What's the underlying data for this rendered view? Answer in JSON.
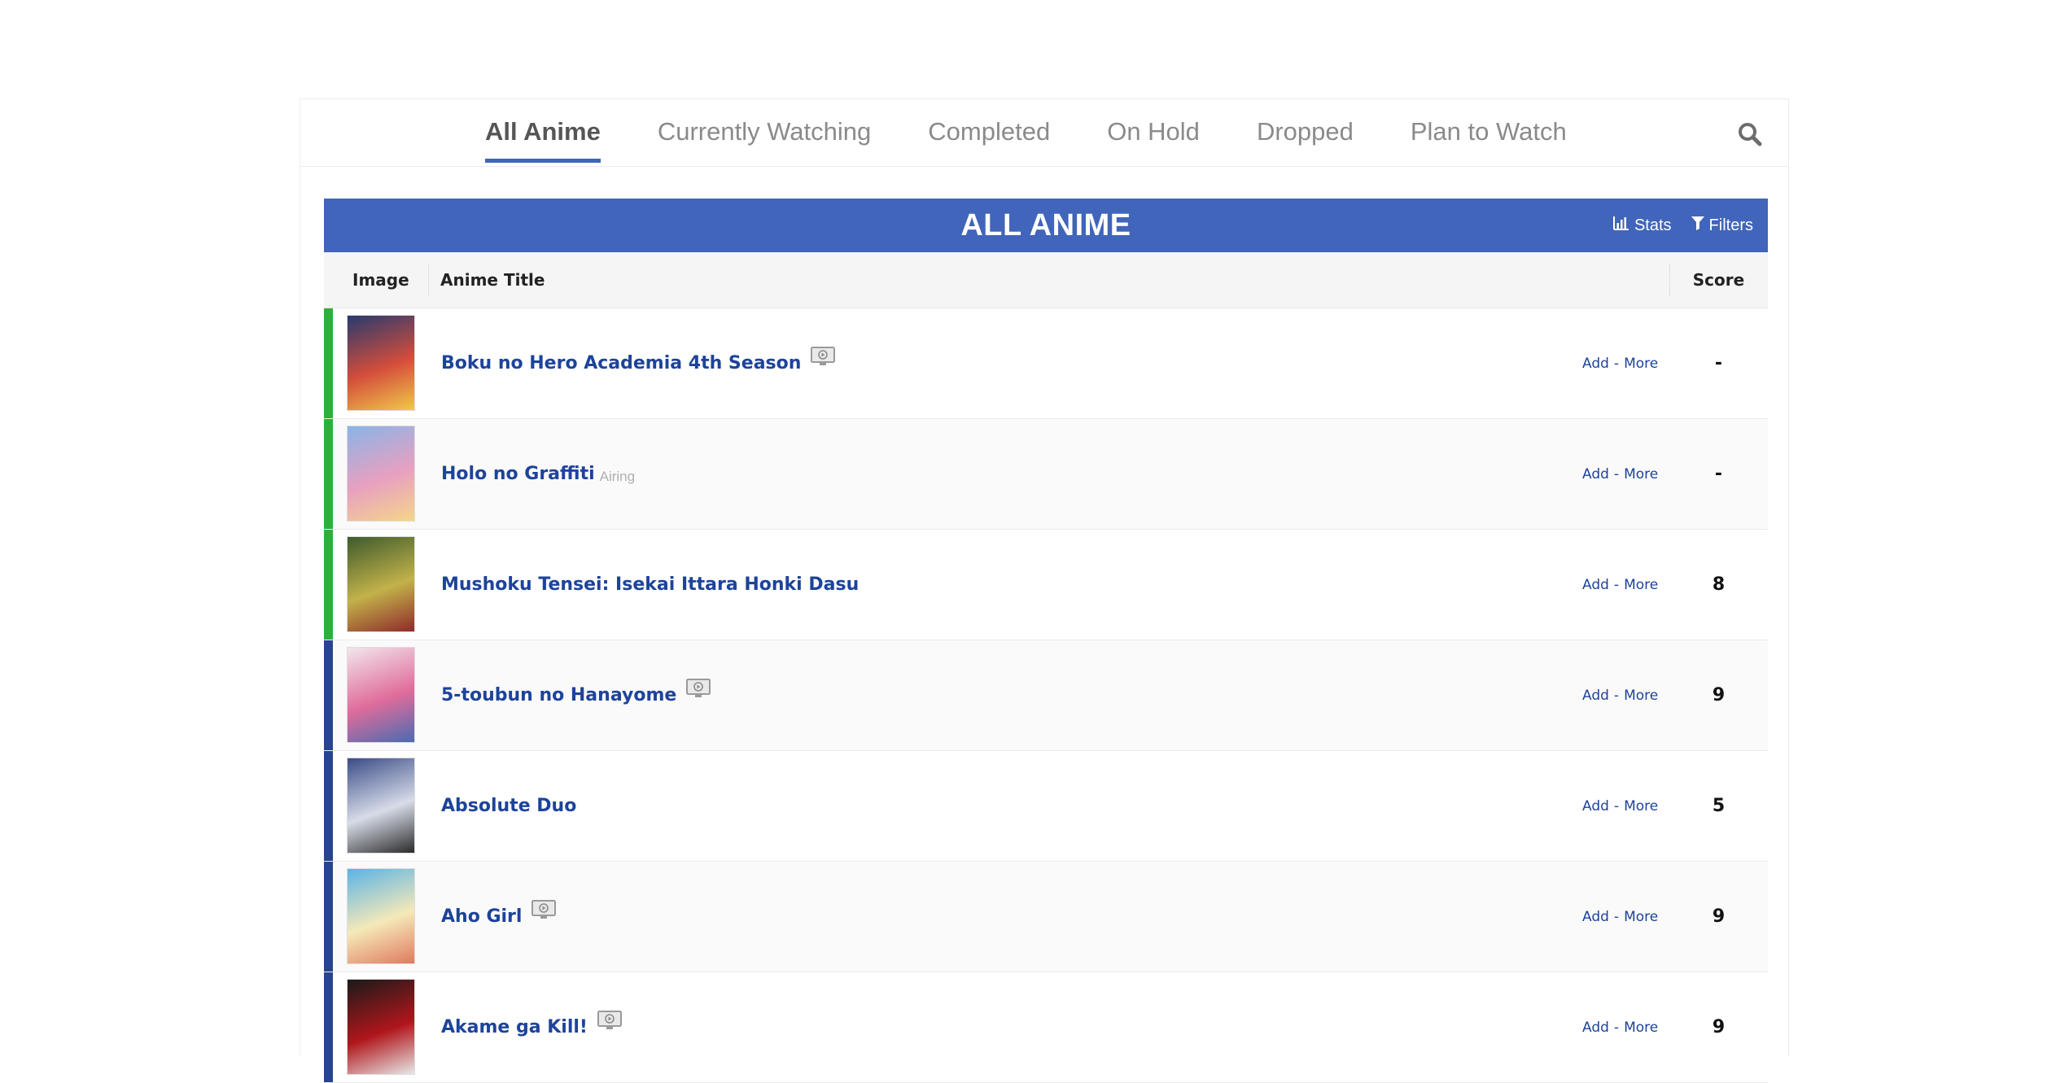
{
  "tabs": [
    {
      "label": "All Anime",
      "active": true
    },
    {
      "label": "Currently Watching",
      "active": false
    },
    {
      "label": "Completed",
      "active": false
    },
    {
      "label": "On Hold",
      "active": false
    },
    {
      "label": "Dropped",
      "active": false
    },
    {
      "label": "Plan to Watch",
      "active": false
    }
  ],
  "list": {
    "title": "ALL ANIME",
    "stats_label": "Stats",
    "filters_label": "Filters",
    "columns": {
      "image": "Image",
      "title": "Anime Title",
      "score": "Score"
    }
  },
  "colors": {
    "accent": "#4065ba",
    "watching": "#2db039",
    "completed": "#26448f",
    "link": "#1d439b"
  },
  "rows": [
    {
      "title": "Boku no Hero Academia 4th Season",
      "airing": "",
      "has_video": true,
      "add": "Add",
      "more": "More",
      "score": "-",
      "status": "watching",
      "thumb_colors": [
        "#283a6e",
        "#d44d3b",
        "#f0c94a"
      ]
    },
    {
      "title": "Holo no Graffiti",
      "airing": "Airing",
      "has_video": false,
      "add": "Add",
      "more": "More",
      "score": "-",
      "status": "watching",
      "thumb_colors": [
        "#8ab4e8",
        "#e8a0c0",
        "#f5d58a"
      ]
    },
    {
      "title": "Mushoku Tensei: Isekai Ittara Honki Dasu",
      "airing": "",
      "has_video": false,
      "add": "Add",
      "more": "More",
      "score": "8",
      "status": "watching",
      "thumb_colors": [
        "#3d5a2c",
        "#c2b24a",
        "#8f2a2a"
      ]
    },
    {
      "title": "5-toubun no Hanayome",
      "airing": "",
      "has_video": true,
      "add": "Add",
      "more": "More",
      "score": "9",
      "status": "completed",
      "thumb_colors": [
        "#f2e6ec",
        "#e06c9b",
        "#4a6bb0"
      ]
    },
    {
      "title": "Absolute Duo",
      "airing": "",
      "has_video": false,
      "add": "Add",
      "more": "More",
      "score": "5",
      "status": "completed",
      "thumb_colors": [
        "#3a4c88",
        "#d7dce8",
        "#2b2b2b"
      ]
    },
    {
      "title": "Aho Girl",
      "airing": "",
      "has_video": true,
      "add": "Add",
      "more": "More",
      "score": "9",
      "status": "completed",
      "thumb_colors": [
        "#5bb3e6",
        "#f5e9b8",
        "#e07a5f"
      ]
    },
    {
      "title": "Akame ga Kill!",
      "airing": "",
      "has_video": true,
      "add": "Add",
      "more": "More",
      "score": "9",
      "status": "completed",
      "thumb_colors": [
        "#1a1a1a",
        "#b0161b",
        "#e8e8e8"
      ]
    }
  ],
  "icons": {
    "search": "search-icon",
    "stats": "bar-chart-icon",
    "filters": "filter-icon",
    "video": "video-icon"
  }
}
